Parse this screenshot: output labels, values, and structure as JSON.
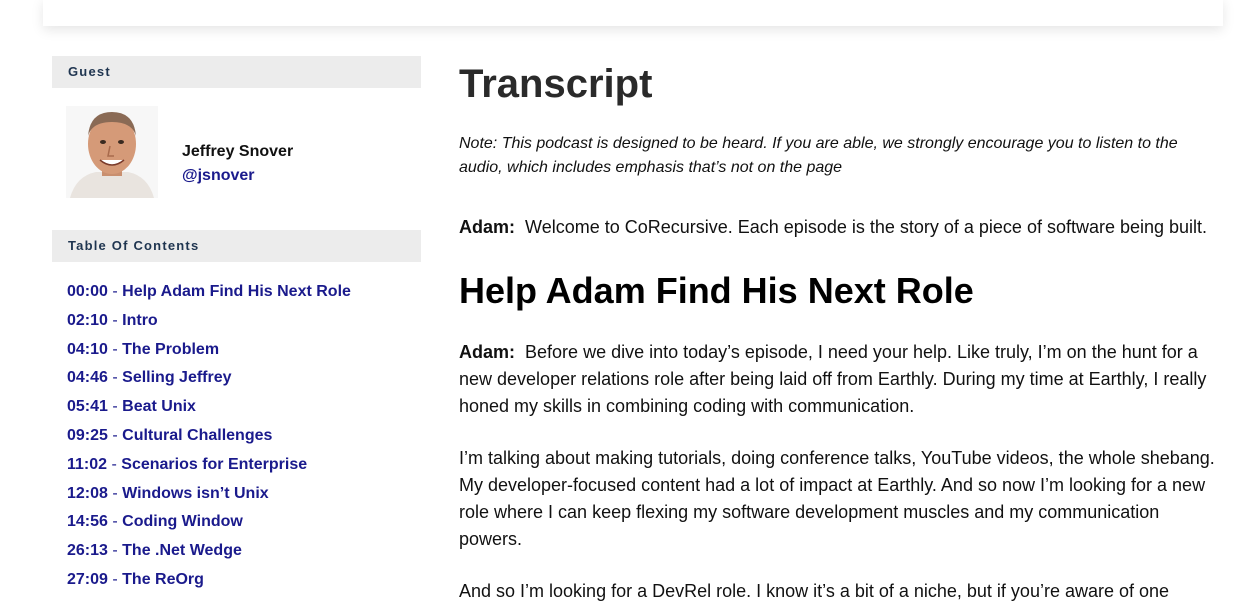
{
  "guest_section": {
    "header": "Guest",
    "name": "Jeffrey Snover",
    "handle": "@jsnover"
  },
  "toc": {
    "header": "Table Of Contents",
    "separator": " - ",
    "items": [
      {
        "time": "00:00",
        "title": "Help Adam Find His Next Role"
      },
      {
        "time": "02:10",
        "title": "Intro"
      },
      {
        "time": "04:10",
        "title": "The Problem"
      },
      {
        "time": "04:46",
        "title": "Selling Jeffrey"
      },
      {
        "time": "05:41",
        "title": "Beat Unix"
      },
      {
        "time": "09:25",
        "title": "Cultural Challenges"
      },
      {
        "time": "11:02",
        "title": "Scenarios for Enterprise"
      },
      {
        "time": "12:08",
        "title": "Windows isn’t Unix"
      },
      {
        "time": "14:56",
        "title": "Coding Window"
      },
      {
        "time": "26:13",
        "title": "The .Net Wedge"
      },
      {
        "time": "27:09",
        "title": "The ReOrg"
      }
    ]
  },
  "main": {
    "title": "Transcript",
    "note": "Note: This podcast is designed to be heard. If you are able, we strongly encourage you to listen to the audio, which includes emphasis that’s not on the page",
    "intro": {
      "speaker": "Adam:",
      "text": "Welcome to CoRecursive. Each episode is the story of a piece of software being built."
    },
    "section_title": "Help Adam Find His Next Role",
    "paragraphs": [
      {
        "speaker": "Adam:",
        "text": "Before we dive into today’s episode, I need your help. Like truly, I’m on the hunt for a new developer relations role after being laid off from Earthly. During my time at Earthly, I really honed my skills in combining coding with communication."
      },
      {
        "speaker": "",
        "text": "I’m talking about making tutorials, doing conference talks, YouTube videos, the whole shebang. My developer-focused content had a lot of impact at Earthly. And so now I’m looking for a new role where I can keep flexing my software development muscles and my communication powers."
      },
      {
        "speaker": "",
        "text": "And so I’m looking for a DevRel role. I know it’s a bit of a niche, but if you’re aware of one"
      }
    ]
  }
}
